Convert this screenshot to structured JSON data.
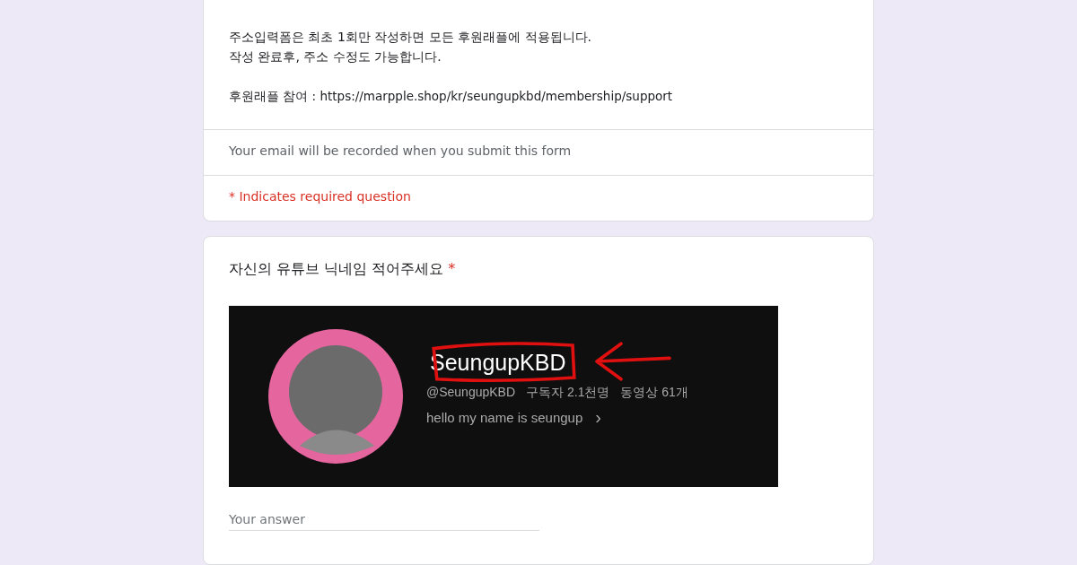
{
  "header_card": {
    "description": [
      "주소입력폼은 최초 1회만 작성하면 모든 후원래플에 적용됩니다.",
      "작성 완료후, 주소 수정도 가능합니다."
    ],
    "participation_line": "후원래플 참여 : https://marpple.shop/kr/seungupkbd/membership/support",
    "email_notice": "Your email will be recorded when you submit this form",
    "required_notice": "* Indicates required question"
  },
  "question": {
    "title": "자신의 유튜브 닉네임 적어주세요",
    "required_mark": "*",
    "image": {
      "channel_name": "SeungupKBD",
      "handle": "@SeungupKBD",
      "subscribers": "구독자 2.1천명",
      "videos": "동영상 61개",
      "about": "hello my name is seungup",
      "about_chevron": "›"
    },
    "answer": {
      "placeholder": "Your answer"
    }
  }
}
